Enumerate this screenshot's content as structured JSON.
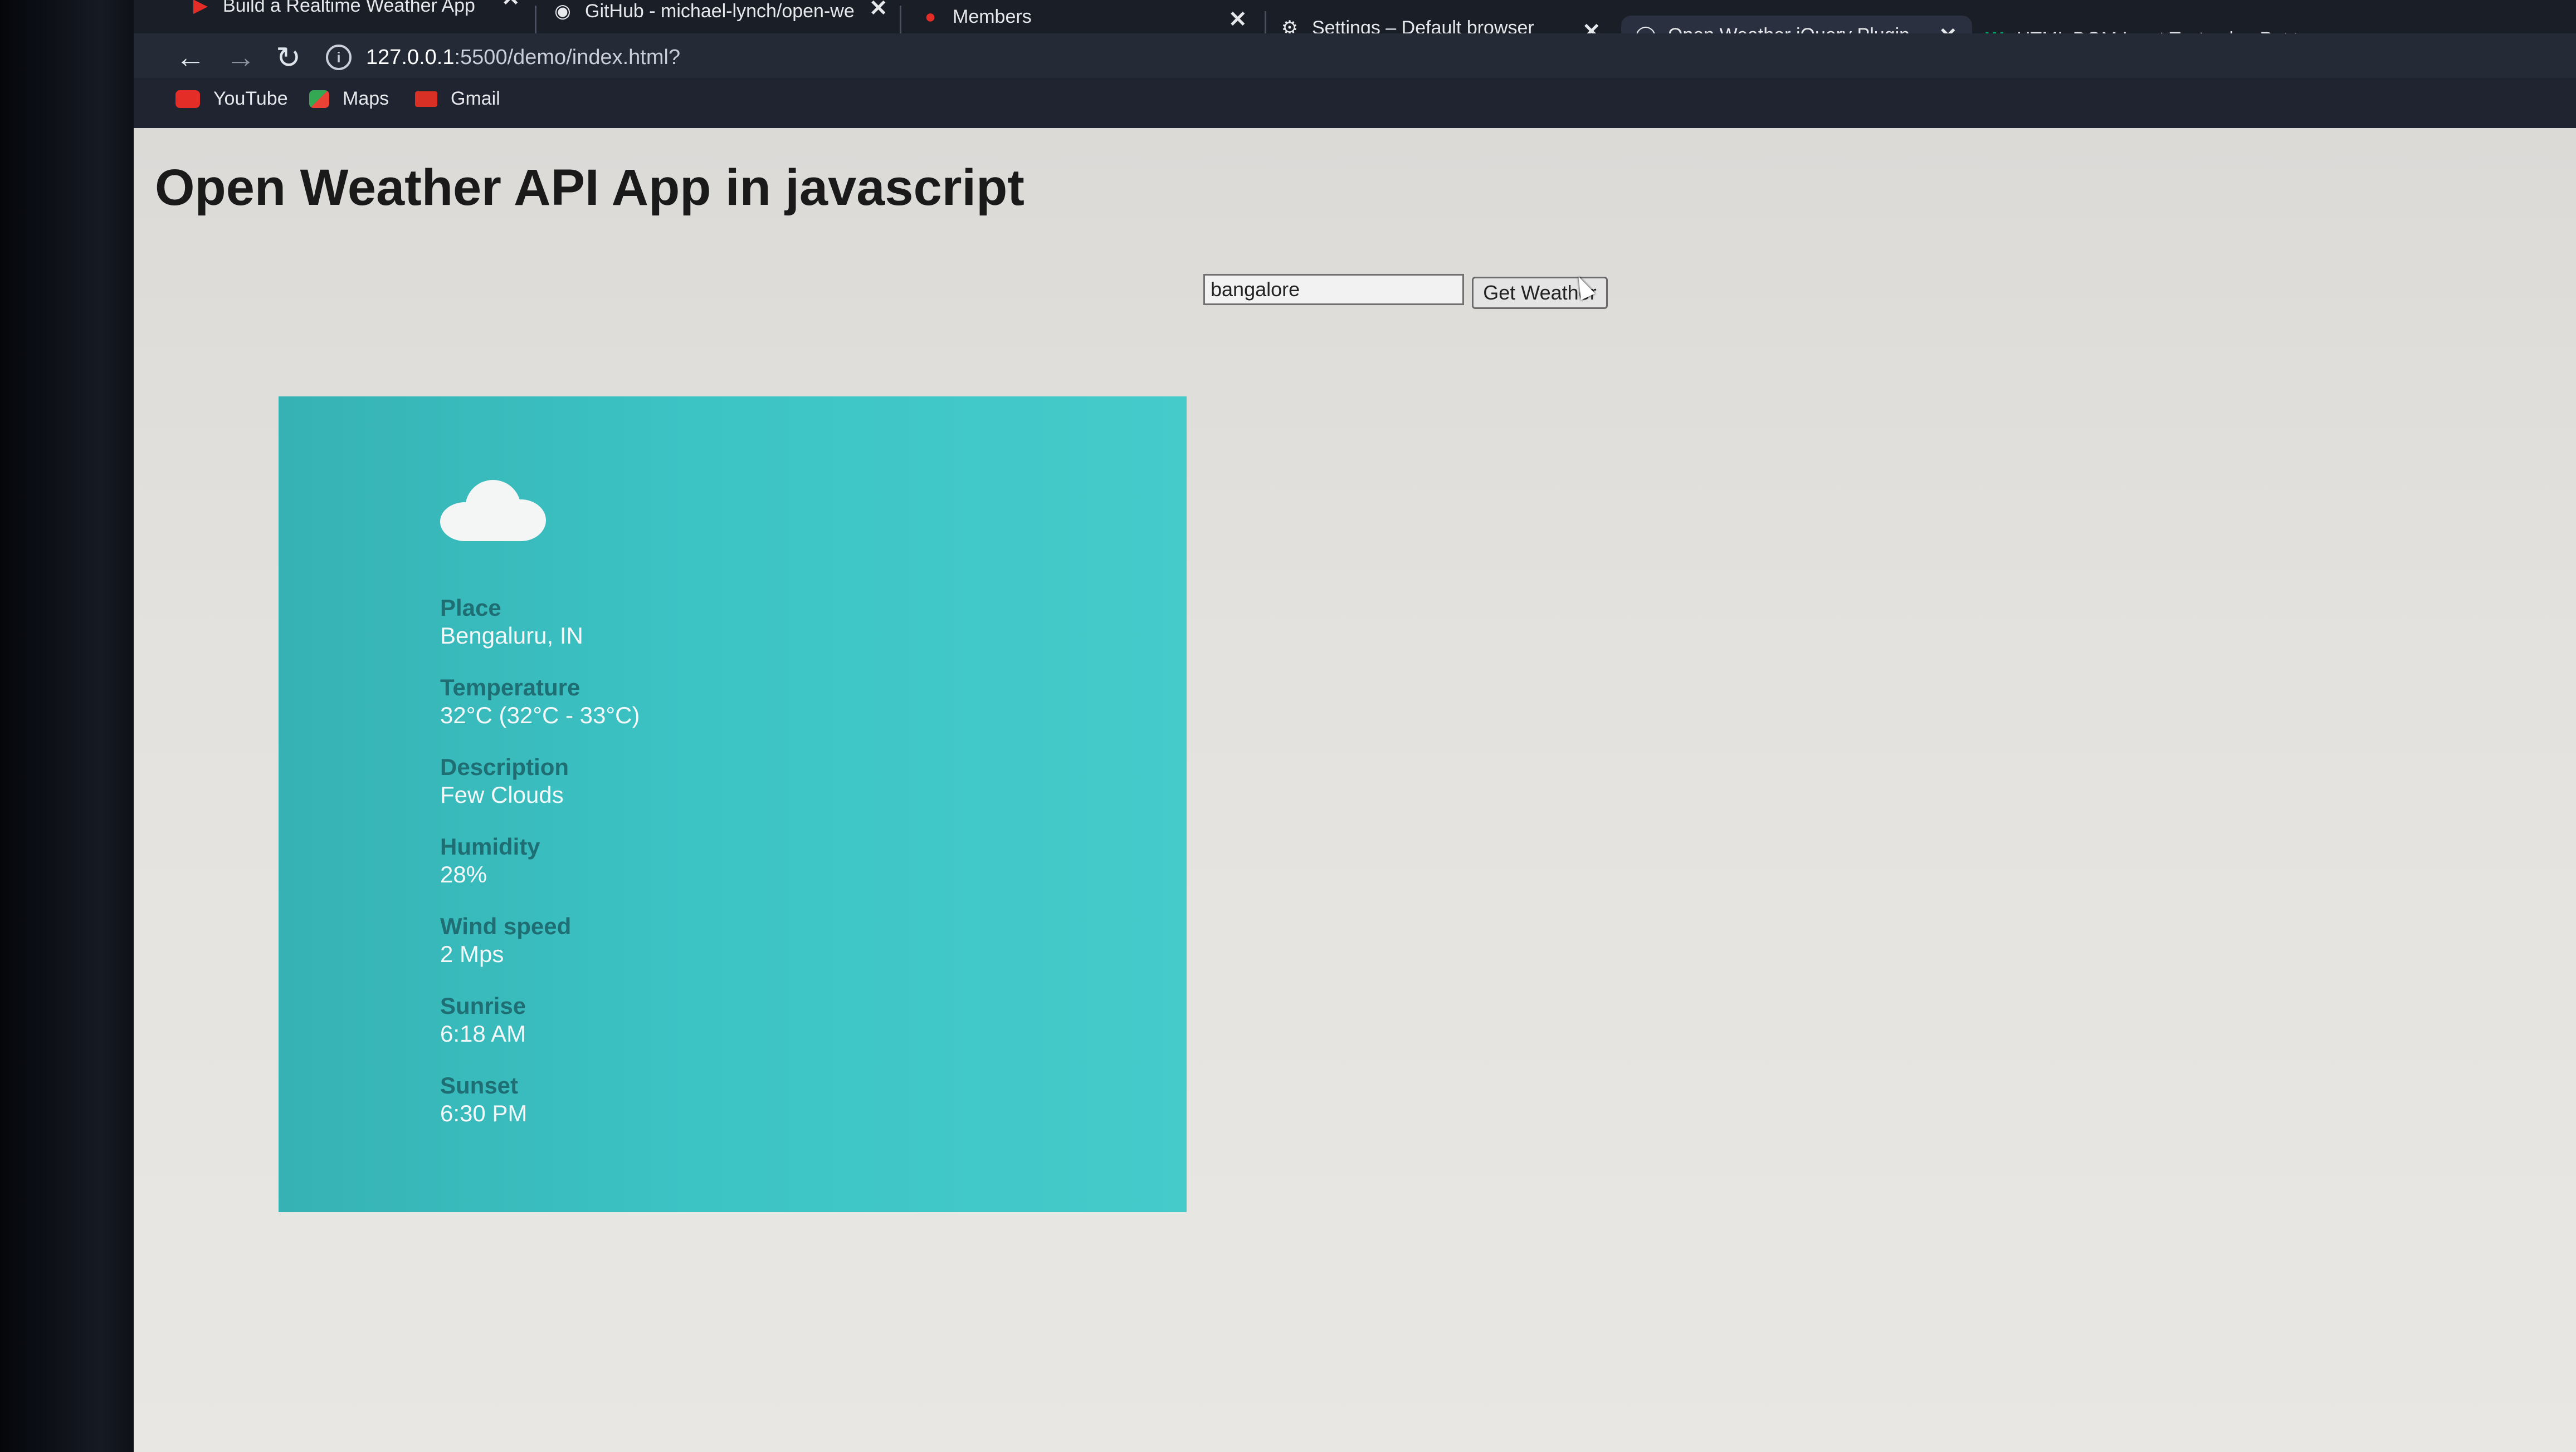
{
  "browser": {
    "tabs": [
      {
        "title": "Build a Realtime Weather App U",
        "favicon": "youtube-icon"
      },
      {
        "title": "GitHub - michael-lynch/open-we",
        "favicon": "github-icon"
      },
      {
        "title": "Members",
        "favicon": "members-icon"
      },
      {
        "title": "Settings – Default browser",
        "favicon": "gear-icon"
      },
      {
        "title": "Open Weather jQuery Plugin",
        "favicon": "globe-icon",
        "active": true
      },
      {
        "title": "HTML DOM Input Text value Pro",
        "favicon": "w3schools-icon"
      }
    ],
    "address": {
      "host": "127.0.0.1",
      "rest": ":5500/demo/index.html?"
    },
    "bookmarks": [
      {
        "label": "YouTube",
        "icon": "youtube-icon",
        "color": "#e52d27"
      },
      {
        "label": "Maps",
        "icon": "maps-icon",
        "color": "#34a853"
      },
      {
        "label": "Gmail",
        "icon": "gmail-icon",
        "color": "#d93025"
      }
    ]
  },
  "page": {
    "title": "Open Weather API App in javascript",
    "search": {
      "value": "bangalore",
      "button_label": "Get Weather"
    },
    "weather": {
      "icon": "cloud-icon",
      "card_color": "#3cc3c4",
      "fields": [
        {
          "label": "Place",
          "value": "Bengaluru, IN"
        },
        {
          "label": "Temperature",
          "value": "32°C (32°C - 33°C)"
        },
        {
          "label": "Description",
          "value": "Few Clouds"
        },
        {
          "label": "Humidity",
          "value": "28%"
        },
        {
          "label": "Wind speed",
          "value": "2 Mps"
        },
        {
          "label": "Sunrise",
          "value": "6:18 AM"
        },
        {
          "label": "Sunset",
          "value": "6:30 PM"
        }
      ]
    }
  }
}
